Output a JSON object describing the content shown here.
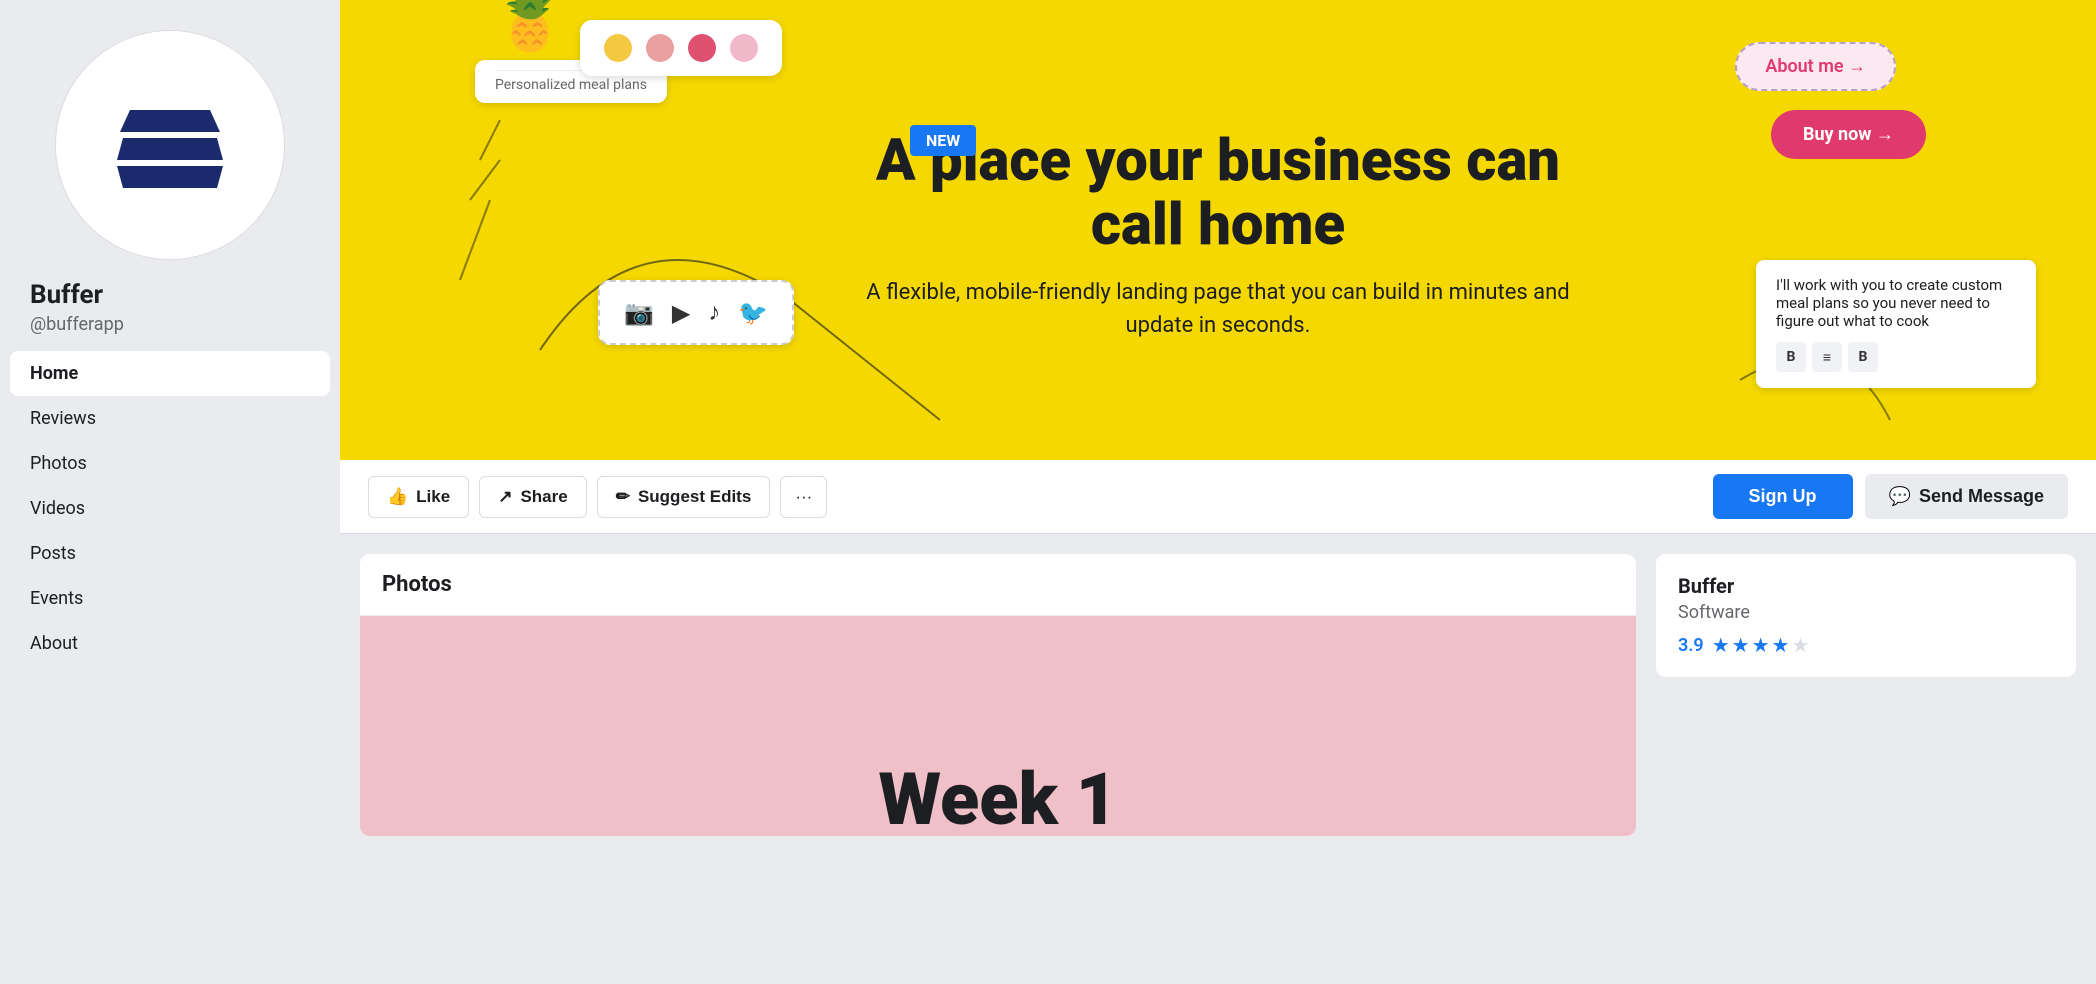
{
  "page": {
    "name": "Buffer",
    "handle": "@bufferapp",
    "title": "Buffer — Facebook Page"
  },
  "sidebar": {
    "nav_items": [
      {
        "id": "home",
        "label": "Home",
        "active": true
      },
      {
        "id": "reviews",
        "label": "Reviews",
        "active": false
      },
      {
        "id": "photos",
        "label": "Photos",
        "active": false
      },
      {
        "id": "videos",
        "label": "Videos",
        "active": false
      },
      {
        "id": "posts",
        "label": "Posts",
        "active": false
      },
      {
        "id": "events",
        "label": "Events",
        "active": false
      },
      {
        "id": "about",
        "label": "About",
        "active": false
      }
    ]
  },
  "cover": {
    "headline": "A place your business can call home",
    "subheadline": "A flexible, mobile-friendly landing page that you can build in minutes and update in seconds.",
    "new_badge": "NEW",
    "about_me_btn": "About me →",
    "buy_now_btn": "Buy now →",
    "meal_card_text": "Personalized meal plans",
    "social_icons": [
      "Instagram",
      "YouTube",
      "TikTok",
      "Twitter"
    ],
    "meal_text_card": "I'll work with you to create custom meal plans so you never need to figure out what to cook"
  },
  "action_bar": {
    "like_btn": "Like",
    "share_btn": "Share",
    "suggest_edits_btn": "Suggest Edits",
    "sign_up_btn": "Sign Up",
    "send_message_btn": "Send Message"
  },
  "photos_section": {
    "title": "Photos",
    "preview_text": "Week 1"
  },
  "info_card": {
    "name": "Buffer",
    "category": "Software",
    "rating": "3.9",
    "stars": [
      true,
      true,
      true,
      true,
      false
    ]
  },
  "colors": {
    "brand_blue": "#1877f2",
    "cover_yellow": "#f5d800",
    "dark_navy": "#1a2a6c",
    "like_pink": "#fce8f0"
  },
  "dots": [
    {
      "color": "#f5c842"
    },
    {
      "color": "#e8a0a0"
    },
    {
      "color": "#e05070"
    },
    {
      "color": "#f0b8c8"
    }
  ]
}
